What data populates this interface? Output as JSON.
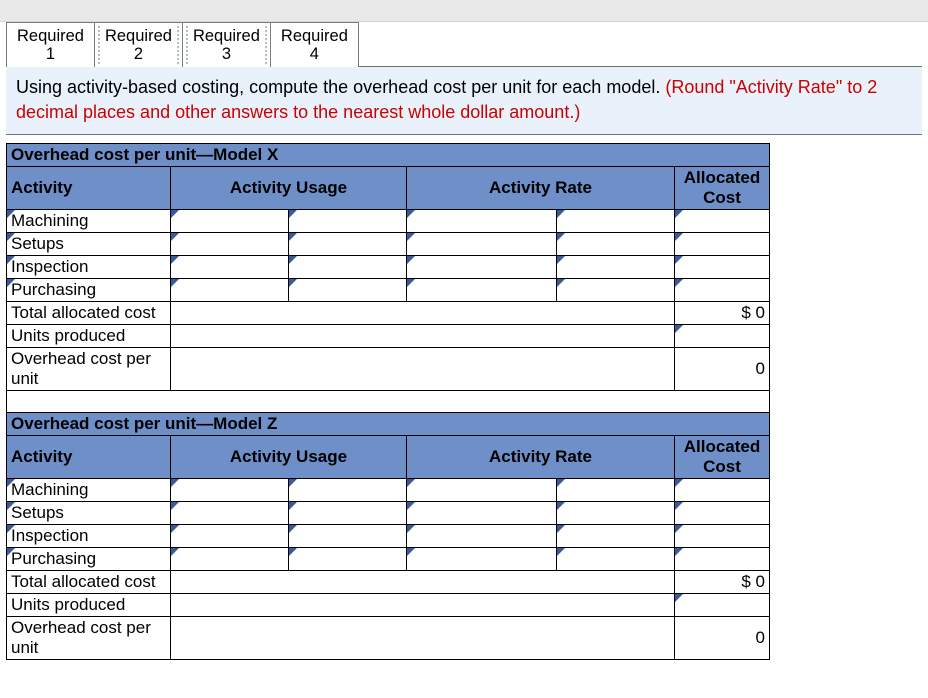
{
  "tabs": [
    {
      "line1": "Required",
      "line2": "1"
    },
    {
      "line1": "Required",
      "line2": "2"
    },
    {
      "line1": "Required",
      "line2": "3"
    },
    {
      "line1": "Required",
      "line2": "4"
    }
  ],
  "instruction": {
    "black": "Using activity-based costing, compute the overhead cost per unit for each model. ",
    "red": "(Round \"Activity Rate\" to 2 decimal places and other answers to the nearest whole dollar amount.)"
  },
  "headers": {
    "activity": "Activity",
    "usage": "Activity Usage",
    "rate": "Activity Rate",
    "allocated": "Allocated Cost"
  },
  "row_labels": {
    "machining": "Machining",
    "setups": "Setups",
    "inspection": "Inspection",
    "purchasing": "Purchasing",
    "total": "Total allocated cost",
    "units": "Units produced",
    "ohpu": "Overhead cost per unit"
  },
  "sections": {
    "x_title": "Overhead cost per unit—Model X",
    "z_title": "Overhead cost per unit—Model Z"
  },
  "values": {
    "currency": "$",
    "x_total": "0",
    "x_ohpu": "0",
    "z_total": "0",
    "z_ohpu": "0"
  }
}
